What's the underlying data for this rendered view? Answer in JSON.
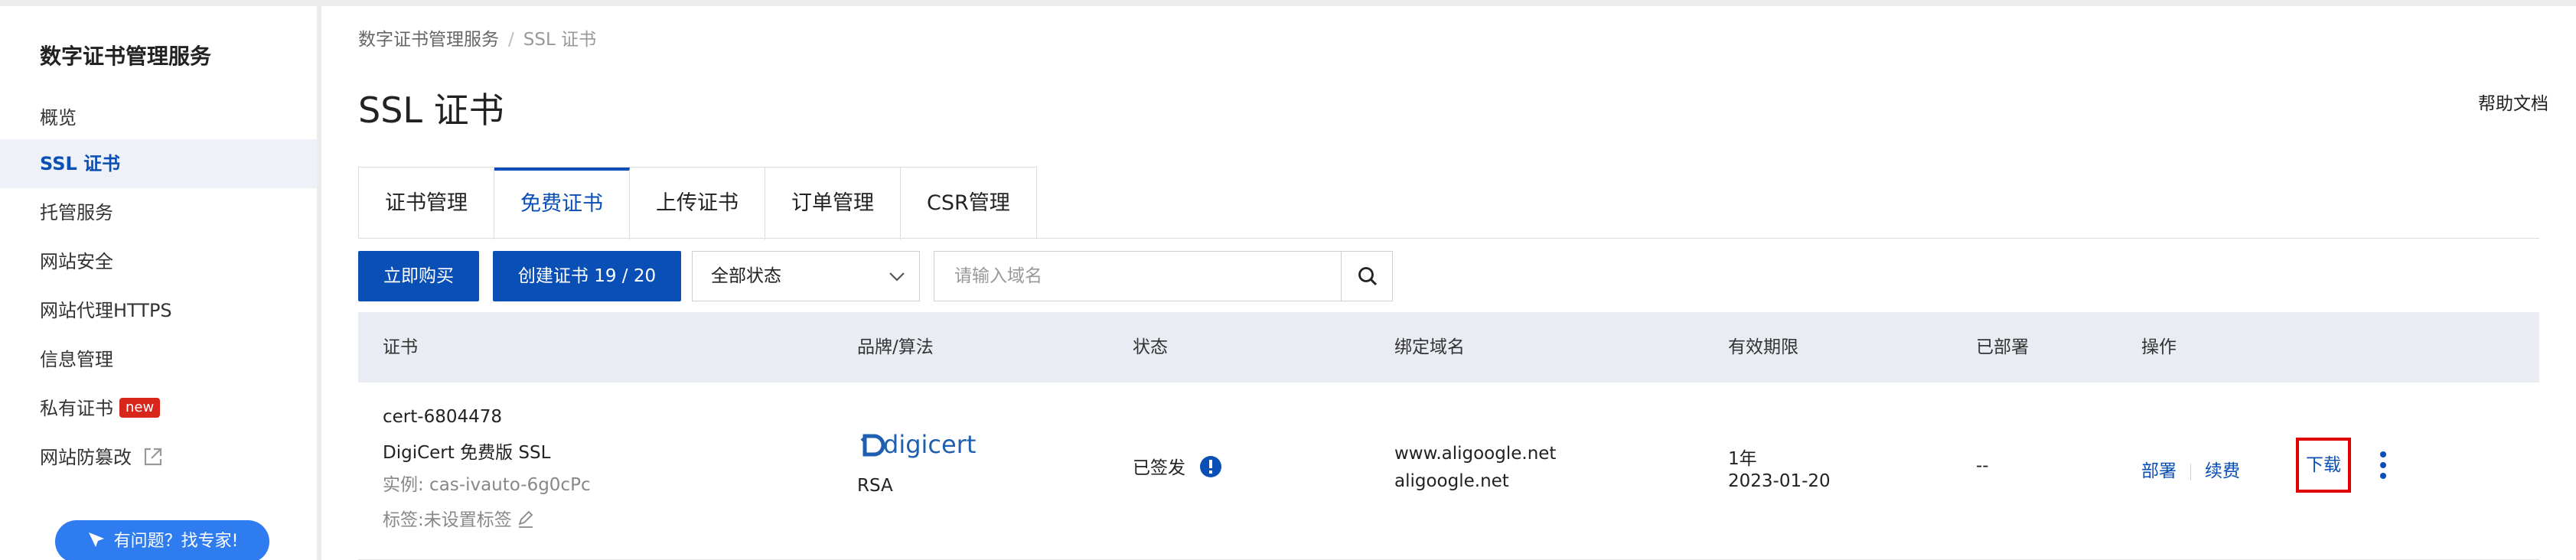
{
  "sidebar": {
    "title": "数字证书管理服务",
    "items": [
      {
        "label": "概览"
      },
      {
        "label": "SSL 证书"
      },
      {
        "label": "托管服务"
      },
      {
        "label": "网站安全"
      },
      {
        "label": "网站代理HTTPS"
      },
      {
        "label": "信息管理"
      },
      {
        "label": "私有证书",
        "badge": "new"
      },
      {
        "label": "网站防篡改"
      }
    ],
    "help_button": "有问题？找专家!"
  },
  "breadcrumb": {
    "root": "数字证书管理服务",
    "separator": "/",
    "current": "SSL 证书"
  },
  "page": {
    "title": "SSL 证书",
    "help_doc": "帮助文档"
  },
  "tabs": [
    {
      "label": "证书管理"
    },
    {
      "label": "免费证书",
      "active": true
    },
    {
      "label": "上传证书"
    },
    {
      "label": "订单管理"
    },
    {
      "label": "CSR管理"
    }
  ],
  "toolbar": {
    "buy_label": "立即购买",
    "create_label": "创建证书 19 / 20",
    "status_select": "全部状态",
    "search_placeholder": "请输入域名"
  },
  "table": {
    "headers": [
      "证书",
      "品牌/算法",
      "状态",
      "绑定域名",
      "有效期限",
      "已部署",
      "操作"
    ],
    "rows": [
      {
        "cert_id": "cert-6804478",
        "cert_name": "DigiCert 免费版 SSL",
        "instance": "实例: cas-ivauto-6g0cPc",
        "tag": "标签:未设置标签",
        "brand_logo": "digicert",
        "algorithm": "RSA",
        "status": "已签发",
        "domain1": "www.aligoogle.net",
        "domain2": "aligoogle.net",
        "validity": "1年",
        "expiry": "2023-01-20",
        "deployed": "--",
        "actions": {
          "deploy": "部署",
          "renew": "续费",
          "download": "下载"
        }
      }
    ]
  },
  "colors": {
    "primary": "#0a4fb5",
    "badge_red": "#d9261c",
    "help_blue": "#2f7cf0",
    "highlight_red": "#e00000"
  }
}
